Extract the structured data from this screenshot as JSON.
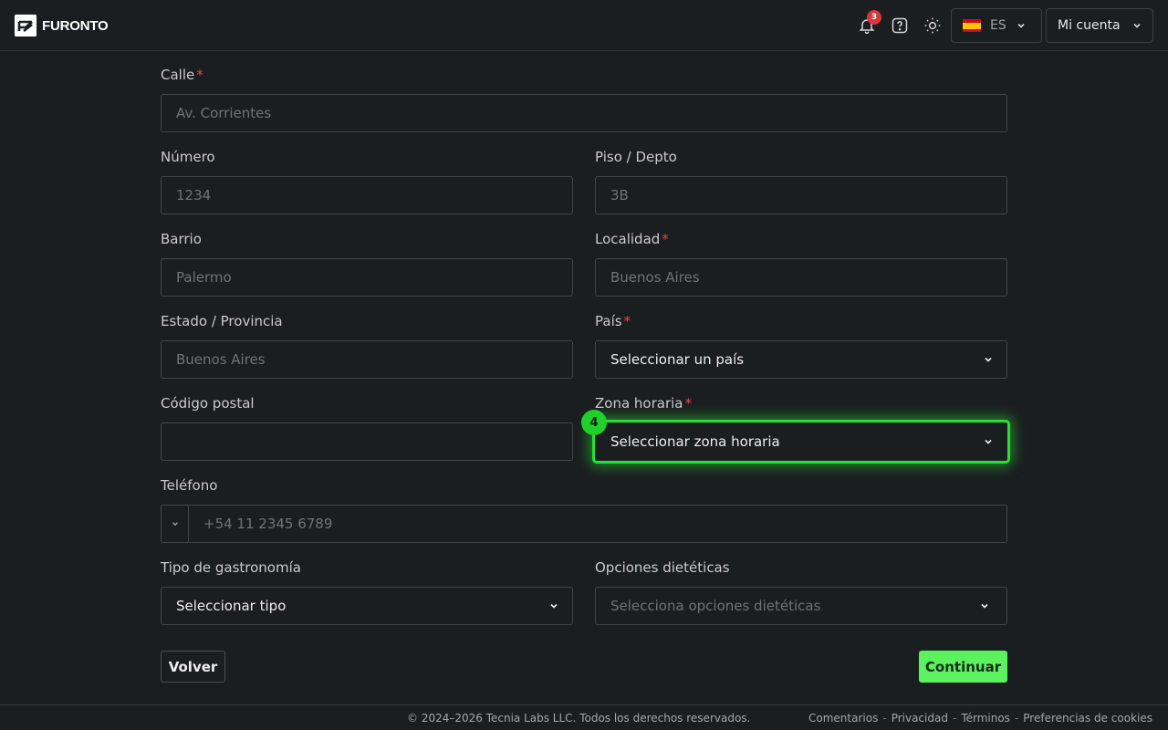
{
  "header": {
    "brand": "FURONTO",
    "notifications_count": "3",
    "language_code": "ES",
    "account_label": "Mi cuenta"
  },
  "form": {
    "street": {
      "label": "Calle",
      "placeholder": "Av. Corrientes",
      "required": true
    },
    "number": {
      "label": "Número",
      "placeholder": "1234"
    },
    "floor": {
      "label": "Piso / Depto",
      "placeholder": "3B"
    },
    "neighborhood": {
      "label": "Barrio",
      "placeholder": "Palermo"
    },
    "locality": {
      "label": "Localidad",
      "placeholder": "Buenos Aires",
      "required": true
    },
    "state": {
      "label": "Estado / Provincia",
      "placeholder": "Buenos Aires"
    },
    "country": {
      "label": "País",
      "value": "Seleccionar un país",
      "required": true
    },
    "postal_code": {
      "label": "Código postal",
      "value": ""
    },
    "timezone": {
      "label": "Zona horaria",
      "value": "Seleccionar zona horaria",
      "required": true,
      "step_marker": "4"
    },
    "phone": {
      "label": "Teléfono",
      "placeholder": "+54 11 2345 6789"
    },
    "cuisine": {
      "label": "Tipo de gastronomía",
      "value": "Seleccionar tipo"
    },
    "dietary": {
      "label": "Opciones dietéticas",
      "placeholder": "Selecciona opciones dietéticas"
    },
    "required_mark": "*"
  },
  "actions": {
    "back": "Volver",
    "continue": "Continuar"
  },
  "footer": {
    "copyright": "© 2024–2026 Tecnia Labs LLC. Todos los derechos reservados.",
    "links": [
      "Comentarios",
      "Privacidad",
      "Términos",
      "Preferencias de cookies"
    ],
    "separator": "-"
  },
  "colors": {
    "background": "#1b1e21",
    "accent": "#5cf25f",
    "highlight": "#27e033",
    "required": "#e5484d",
    "badge": "#d9353b"
  }
}
